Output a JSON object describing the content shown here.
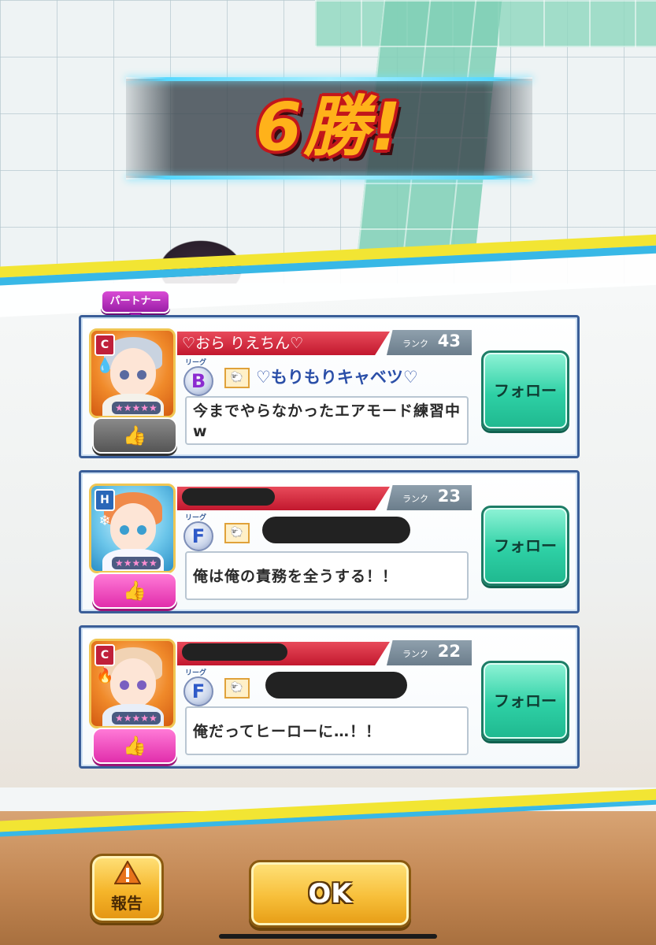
{
  "banner": {
    "wins_text": "6勝!"
  },
  "partner_tag": "パートナー",
  "cards": [
    {
      "player_name": "♡おら りえちん♡",
      "name_redacted": false,
      "rank_label": "ランク",
      "rank": "43",
      "rarity": "C",
      "element_icon": "water-drop-icon",
      "stars": "★★★★★",
      "league_small": "リーグ",
      "league": "B",
      "emblem": "emblem-icon",
      "team_name": "♡もりもりキャベツ♡",
      "team_redacted": false,
      "message": "今までやらなかったエアモード練習中w",
      "like_state": "off",
      "like_icon": "thumbs-up-icon",
      "follow_label": "フォロー"
    },
    {
      "player_name": "",
      "name_redacted": true,
      "rank_label": "ランク",
      "rank": "23",
      "rarity": "H",
      "element_icon": "snowflake-icon",
      "stars": "★★★★★",
      "league_small": "リーグ",
      "league": "F",
      "emblem": "emblem-icon",
      "team_name": "",
      "team_redacted": true,
      "message": "俺は俺の責務を全うする！！",
      "like_state": "on",
      "like_icon": "thumbs-up-icon",
      "follow_label": "フォロー"
    },
    {
      "player_name": "",
      "name_redacted": true,
      "rank_label": "ランク",
      "rank": "22",
      "rarity": "C",
      "element_icon": "fire-icon",
      "stars": "★★★★★",
      "league_small": "リーグ",
      "league": "F",
      "emblem": "emblem-icon",
      "team_name": "",
      "team_redacted": true,
      "message": "俺だってヒーローに…！！",
      "like_state": "on",
      "like_icon": "thumbs-up-icon",
      "follow_label": "フォロー"
    }
  ],
  "report_button": {
    "label": "報告",
    "icon": "warning-icon"
  },
  "ok_button": {
    "label": "OK"
  },
  "colors": {
    "accent_red": "#c2182e",
    "follow_green": "#2ed0a5",
    "like_pink": "#e12eab",
    "button_gold": "#f5b52a",
    "card_border": "#3a5e98"
  }
}
